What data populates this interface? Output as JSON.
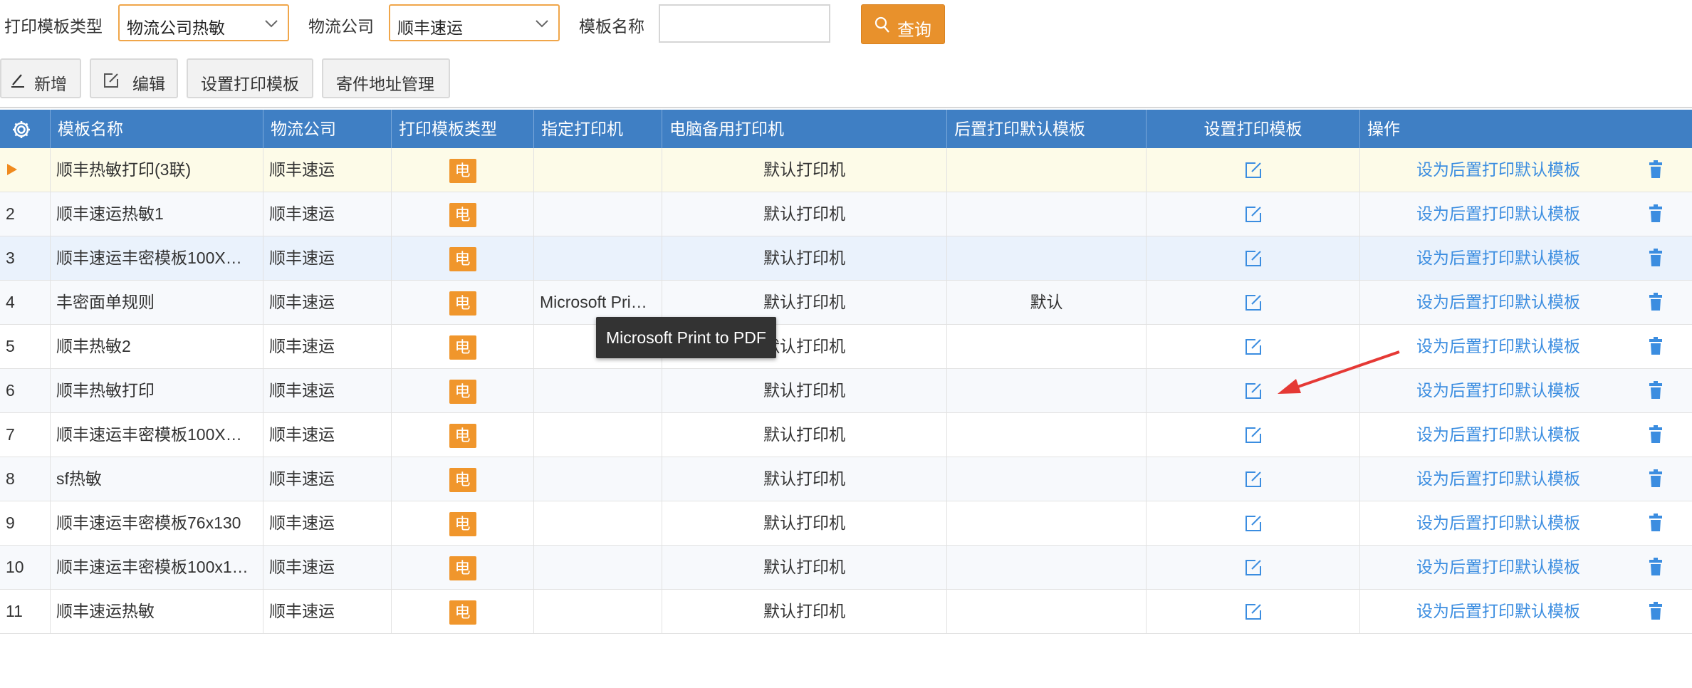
{
  "filters": {
    "template_type_label": "打印模板类型",
    "template_type_value": "物流公司热敏",
    "logistics_label": "物流公司",
    "logistics_value": "顺丰速运",
    "template_name_label": "模板名称",
    "template_name_value": "",
    "query_label": "查询"
  },
  "toolbar": {
    "add_label": "新增",
    "edit_label": "编辑",
    "set_template_label": "设置打印模板",
    "sender_address_label": "寄件地址管理"
  },
  "grid": {
    "columns": {
      "name": "模板名称",
      "company": "物流公司",
      "type": "打印模板类型",
      "printer": "指定打印机",
      "backup_printer": "电脑备用打印机",
      "post_default": "后置打印默认模板",
      "set_template": "设置打印模板",
      "ops": "操作"
    },
    "rows": [
      {
        "no": "",
        "name": "顺丰热敏打印(3联)",
        "company": "顺丰速运",
        "type": "电",
        "printer": "",
        "backup_printer": "默认打印机",
        "post_default": "",
        "action": "设为后置打印默认模板"
      },
      {
        "no": "2",
        "name": "顺丰速运热敏1",
        "company": "顺丰速运",
        "type": "电",
        "printer": "",
        "backup_printer": "默认打印机",
        "post_default": "",
        "action": "设为后置打印默认模板"
      },
      {
        "no": "3",
        "name": "顺丰速运丰密模板100X…",
        "company": "顺丰速运",
        "type": "电",
        "printer": "",
        "backup_printer": "默认打印机",
        "post_default": "",
        "action": "设为后置打印默认模板"
      },
      {
        "no": "4",
        "name": "丰密面单规则",
        "company": "顺丰速运",
        "type": "电",
        "printer": "Microsoft Pri…",
        "backup_printer": "默认打印机",
        "post_default": "默认",
        "action": "设为后置打印默认模板"
      },
      {
        "no": "5",
        "name": "顺丰热敏2",
        "company": "顺丰速运",
        "type": "电",
        "printer": "",
        "backup_printer": "默认打印机",
        "post_default": "",
        "action": "设为后置打印默认模板"
      },
      {
        "no": "6",
        "name": "顺丰热敏打印",
        "company": "顺丰速运",
        "type": "电",
        "printer": "",
        "backup_printer": "默认打印机",
        "post_default": "",
        "action": "设为后置打印默认模板"
      },
      {
        "no": "7",
        "name": "顺丰速运丰密模板100X…",
        "company": "顺丰速运",
        "type": "电",
        "printer": "",
        "backup_printer": "默认打印机",
        "post_default": "",
        "action": "设为后置打印默认模板"
      },
      {
        "no": "8",
        "name": "sf热敏",
        "company": "顺丰速运",
        "type": "电",
        "printer": "",
        "backup_printer": "默认打印机",
        "post_default": "",
        "action": "设为后置打印默认模板"
      },
      {
        "no": "9",
        "name": "顺丰速运丰密模板76x130",
        "company": "顺丰速运",
        "type": "电",
        "printer": "",
        "backup_printer": "默认打印机",
        "post_default": "",
        "action": "设为后置打印默认模板"
      },
      {
        "no": "10",
        "name": "顺丰速运丰密模板100x1…",
        "company": "顺丰速运",
        "type": "电",
        "printer": "",
        "backup_printer": "默认打印机",
        "post_default": "",
        "action": "设为后置打印默认模板"
      },
      {
        "no": "11",
        "name": "顺丰速运热敏",
        "company": "顺丰速运",
        "type": "电",
        "printer": "",
        "backup_printer": "默认打印机",
        "post_default": "",
        "action": "设为后置打印默认模板"
      }
    ]
  },
  "tooltip": {
    "text": "Microsoft Print to PDF"
  },
  "icons": {
    "settings": "gear-icon",
    "search": "search-icon",
    "dropdown": "chevron-down-icon",
    "add": "pen-icon",
    "edit": "edit-icon",
    "delete": "trash-icon",
    "current_row": "row-pointer-icon"
  },
  "colors": {
    "accent": "#e8912c",
    "header": "#3f7fc4",
    "link": "#3b8de0",
    "badge": "#f0962c",
    "annotation": "#e53935"
  }
}
